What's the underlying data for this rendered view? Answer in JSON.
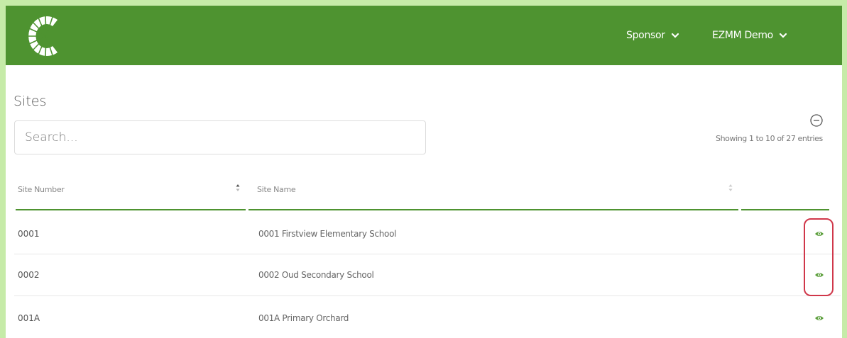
{
  "header": {
    "logo_icon": "c-brand-logo",
    "menus": [
      {
        "label": "Sponsor",
        "icon": "chevron-down-icon"
      },
      {
        "label": "EZMM Demo",
        "icon": "chevron-down-icon"
      }
    ],
    "color": "#4e9330"
  },
  "page": {
    "title": "Sites",
    "collapse_icon": "minus-circle-icon"
  },
  "search": {
    "placeholder": "Search...",
    "value": ""
  },
  "entries_info": "Showing 1 to 10 of 27 entries",
  "table": {
    "columns": [
      {
        "label": "Site Number",
        "sortable": true
      },
      {
        "label": "Site Name",
        "sortable": true
      },
      {
        "label": "",
        "sortable": false
      }
    ],
    "rows": [
      {
        "site_number": "0001",
        "site_name": "0001 Firstview Elementary School",
        "action_icon": "eye-icon"
      },
      {
        "site_number": "0002",
        "site_name": "0002 Oud Secondary School",
        "action_icon": "eye-icon"
      },
      {
        "site_number": "001A",
        "site_name": "001A Primary Orchard",
        "action_icon": "eye-icon"
      }
    ]
  },
  "annotation": {
    "type": "highlight-outline",
    "color": "#d0374a"
  }
}
